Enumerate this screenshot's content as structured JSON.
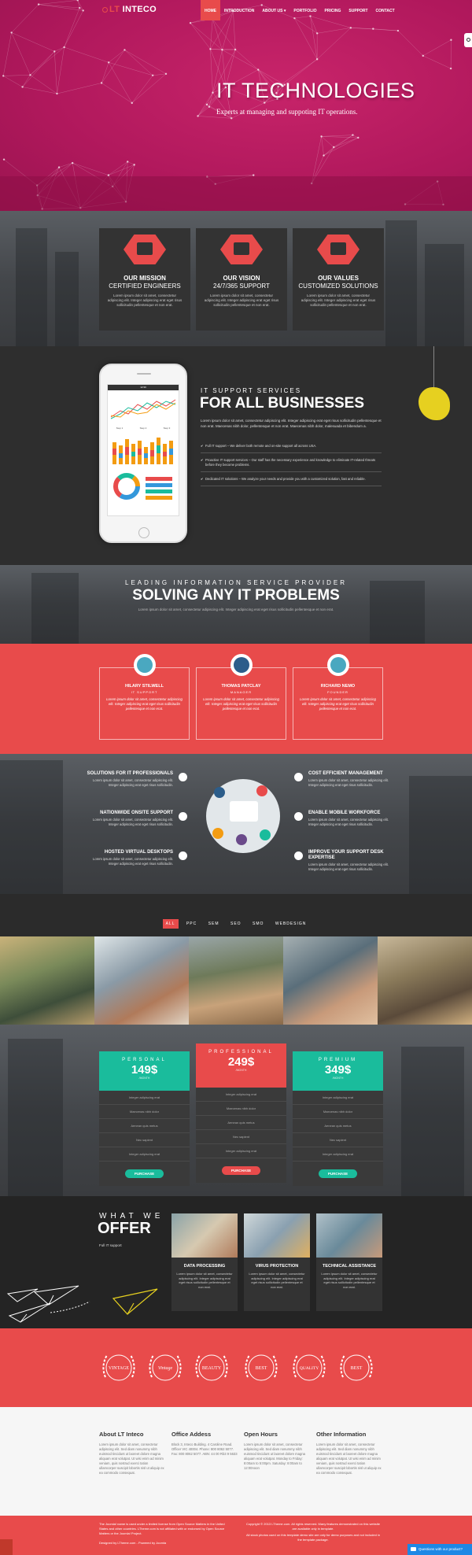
{
  "nav": {
    "logo_prefix": "LT",
    "logo_name": "INTECO",
    "links": [
      "HOME",
      "INTRODUCTION",
      "ABOUT US ▾",
      "PORTFOLIO",
      "PRICING",
      "SUPPORT",
      "CONTACT"
    ]
  },
  "hero": {
    "title": "IT TECHNOLOGIES",
    "subtitle": "Experts at managing and suppoting IT operations."
  },
  "features": [
    {
      "title": "OUR MISSION",
      "subtitle": "CERTIFIED ENGINEERS",
      "icon": "laptop-icon",
      "text": "Lorem ipsum dolor sit amet, consectetur adipiscing elit. Integer adipiscing erat eget risus sollicitudin pellentesque et non erat."
    },
    {
      "title": "OUR VISION",
      "subtitle": "24/7/365 SUPPORT",
      "icon": "devices-icon",
      "text": "Lorem ipsum dolor sit amet, consectetur adipiscing elit. Integer adipiscing erat eget risus sollicitudin pellentesque et non erat."
    },
    {
      "title": "OUR VALUES",
      "subtitle": "CUSTOMIZED SOLUTIONS",
      "icon": "box-icon",
      "text": "Lorem ipsum dolor sit amet, consectetur adipiscing elit. Integer adipiscing erat eget risus sollicitudin pellentesque et non erat."
    }
  ],
  "support": {
    "overline": "IT SUPPORT SERVICES",
    "title": "FOR ALL BUSINESSES",
    "text": "Lorem ipsum dolor sit amet, consectetur adipiscing elit. Integer adipiscing erat eget risus sollicitudin pellentesque et non erat. Maecenas nibh dolor, pellentesque et non erat. Maecenas nibh dolor, malesuada et bibendum a.",
    "list": [
      "Full IT support – We deliver both remote and on-site support all across USA.",
      "Proactive IT support services – Our staff has the necessary experience and knowledge to eliminate IT-related threats before they become problems.",
      "Dedicated IT solutions – We analyze your needs and provide you with a customized solution, fast and reliable."
    ],
    "phone": {
      "time": "12:30",
      "steps": [
        "Step 1",
        "Step 2",
        "Step 3"
      ]
    }
  },
  "solving": {
    "overline": "LEADING INFORMATION SERVICE PROVIDER",
    "title": "SOLVING ANY IT PROBLEMS",
    "sub": "Lorem ipsum dolor sit amet, consectetur adipiscing elit. Integer adipiscing erat eget risus sollicitudin pellentesque et non erat."
  },
  "team": [
    {
      "name": "HILARY STILWELL",
      "role": "IT SUPPORT",
      "text": "Lorem ipsum dolor sit amet, consectetur adipiscing elit. Integer adipiscing erat eget risus sollicitudin pellentesque et non erat."
    },
    {
      "name": "THOMAS PATCLAY",
      "role": "MANAGER",
      "text": "Lorem ipsum dolor sit amet, consectetur adipiscing elit. Integer adipiscing erat eget risus sollicitudin pellentesque et non erat."
    },
    {
      "name": "RICHARD NEMO",
      "role": "FOUNDER",
      "text": "Lorem ipsum dolor sit amet, consectetur adipiscing elit. Integer adipiscing erat eget risus sollicitudin pellentesque et non erat."
    }
  ],
  "services": {
    "left": [
      {
        "title": "SOLUTIONS FOR IT PROFESSIONALS",
        "text": "Lorem ipsum dolor sit amet, consectetur adipiscing elit. Integer adipiscing erat eget risus sollicitudin."
      },
      {
        "title": "NATIONWIDE ONSITE SUPPORT",
        "text": "Lorem ipsum dolor sit amet, consectetur adipiscing elit. Integer adipiscing erat eget risus sollicitudin."
      },
      {
        "title": "HOSTED VIRTUAL DESKTOPS",
        "text": "Lorem ipsum dolor sit amet, consectetur adipiscing elit. Integer adipiscing erat eget risus sollicitudin."
      }
    ],
    "right": [
      {
        "title": "COST EFFICIENT MANAGEMENT",
        "text": "Lorem ipsum dolor sit amet, consectetur adipiscing elit. Integer adipiscing erat eget risus sollicitudin."
      },
      {
        "title": "ENABLE MOBILE WORKFORCE",
        "text": "Lorem ipsum dolor sit amet, consectetur adipiscing elit. Integer adipiscing erat eget risus sollicitudin."
      },
      {
        "title": "IMPROVE YOUR SUPPORT DESK EXPERTISE",
        "text": "Lorem ipsum dolor sit amet, consectetur adipiscing elit. Integer adipiscing erat eget risus sollicitudin."
      }
    ]
  },
  "filters": [
    "ALL",
    "PPC",
    "SEM",
    "SEO",
    "SMO",
    "WEBDESIGN"
  ],
  "pricing": [
    {
      "name": "PERSONAL",
      "price": "149$",
      "per": "/MONTH",
      "color": "#1abc9c",
      "button": "PURCHASE",
      "rows": [
        "Integer adipiscing erat",
        "Maecenas nibh dolor",
        "Aenean quis metus",
        "Nec sapient",
        "Integer adipiscing erat"
      ]
    },
    {
      "name": "PROFESSIONAL",
      "price": "249$",
      "per": "/MONTH",
      "color": "#e84b4b",
      "button": "PURCHASE",
      "rows": [
        "Integer adipiscing erat",
        "Maecenas nibh dolor",
        "Aenean quis metus",
        "Nec sapient",
        "Integer adipiscing erat"
      ]
    },
    {
      "name": "PREMIUM",
      "price": "349$",
      "per": "/MONTH",
      "color": "#1abc9c",
      "button": "PURCHASE",
      "rows": [
        "Integer adipiscing erat",
        "Maecenas nibh dolor",
        "Aenean quis metus",
        "Nec sapient",
        "Integer adipiscing erat"
      ]
    }
  ],
  "offer": {
    "overline": "WHAT WE",
    "title": "OFFER",
    "sub": "Full IT support",
    "cards": [
      {
        "title": "DATA PROCESSING",
        "text": "Lorem ipsum dolor sit amet, consectetur adipiscing elit. Integer adipiscing erat eget risus sollicitudin pellentesque et non erat."
      },
      {
        "title": "VIRUS PROTECTION",
        "text": "Lorem ipsum dolor sit amet, consectetur adipiscing elit. Integer adipiscing erat eget risus sollicitudin pellentesque et non erat."
      },
      {
        "title": "TECHNICAL ASSISTANCE",
        "text": "Lorem ipsum dolor sit amet, consectetur adipiscing elit. Integer adipiscing erat eget risus sollicitudin pellentesque et non erat."
      }
    ]
  },
  "badges": [
    "VINTAGE",
    "Vintage",
    "BEAUTY",
    "BEST",
    "QUALITY",
    "BEST"
  ],
  "footer": {
    "cols": [
      {
        "title": "About LT Inteco",
        "text": "Lorem ipsum dolor sit amet, consectetur adipiscing elit. Sed diam nonummy nibh euismod tincidunt ut laoreet dolore magna aliquam erat volutpat. Ut wisi enim ad minim veniam, quis nostrud exerci tation ullamcorper suscipit lobortis nisl ut aliquip ex ea commodo consequat."
      },
      {
        "title": "Office Addess",
        "text": "Block 3, Inteco Building. 4 Caroline Road. Officer VIC 40004. Phone: 800 8062 5077. Fax: 800 8062 5077. ABN: 44 00 Rb3 9 5633"
      },
      {
        "title": "Open Hours",
        "text": "Lorem ipsum dolor sit amet, consectetur adipiscing elit. Sed diam nonummy nibh euismod tincidunt ut laoreet dolore magna aliquam erat volutpat. Monday to Friday: 8:00am to 5:00pm. Saturday: 8:00am to 12:00noon"
      },
      {
        "title": "Other Information",
        "text": "Lorem ipsum dolor sit amet, consectetur adipiscing elit. Sed diam nonummy nibh euismod tincidunt ut laoreet dolore magna aliquam erat volutpat. Ut wisi enim ad minim veniam, quis nostrud exerci tation ullamcorper suscipit lobortis nisl ut aliquip ex ea commodo consequat."
      }
    ]
  },
  "bottom": {
    "left": "The Joomla! name is used under a limited license from Open Source Matters in the United States and other countries. LTheme.com is not affiliated with or endorsed by Open Source Matters or the Joomla! Project.",
    "designed": "Designed by LTheme.com - Powered by Joomla",
    "right": "Copyright © 2013 LTheme.com. All rights reserved. Many features demonstrated on this website are available only in template.",
    "right2": "All stock photos used on this template demo site are only for demo purposes and not included in the template package.",
    "chat": "Questions with our product?"
  }
}
